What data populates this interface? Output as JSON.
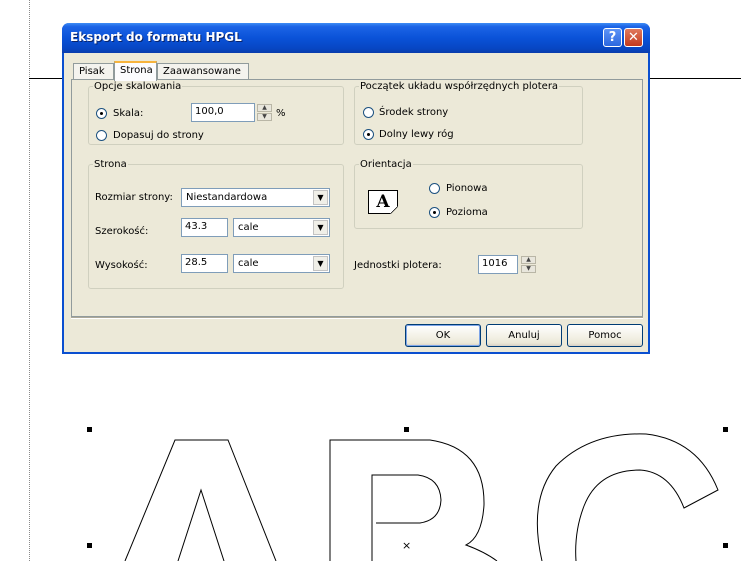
{
  "dialog": {
    "title": "Eksport do formatu HPGL",
    "help_glyph": "?",
    "close_glyph": "✕",
    "tabs": [
      {
        "label": "Pisak"
      },
      {
        "label": "Strona"
      },
      {
        "label": "Zaawansowane"
      }
    ],
    "active_tab": "Strona",
    "scaling": {
      "legend": "Opcje skalowania",
      "scale_label": "Skala:",
      "scale_value": "100,0",
      "percent_unit": "%",
      "fit_label": "Dopasuj do strony",
      "selected": "Skala:"
    },
    "origin": {
      "legend": "Początek układu współrzędnych plotera",
      "center_label": "Środek strony",
      "bottom_left_label": "Dolny lewy róg",
      "selected": "Dolny lewy róg"
    },
    "page": {
      "legend": "Strona",
      "size_label": "Rozmiar strony:",
      "size_value": "Niestandardowa",
      "width_label": "Szerokość:",
      "width_value": "43.3",
      "width_unit": "cale",
      "height_label": "Wysokość:",
      "height_value": "28.5",
      "height_unit": "cale"
    },
    "orientation": {
      "legend": "Orientacja",
      "icon_letter": "A",
      "portrait_label": "Pionowa",
      "landscape_label": "Pozioma",
      "selected": "Pozioma"
    },
    "plotter_units": {
      "label": "Jednostki plotera:",
      "value": "1016"
    },
    "buttons": {
      "ok": "OK",
      "cancel": "Anuluj",
      "help": "Pomoc"
    }
  },
  "canvas": {
    "center_marker": "×",
    "artwork": "outlined letters A B C"
  },
  "colors": {
    "titlebar": "#0a52d8",
    "dialog_bg": "#ece9d8",
    "active_tab_highlight": "#f7b43d",
    "close_button": "#c3391c"
  }
}
